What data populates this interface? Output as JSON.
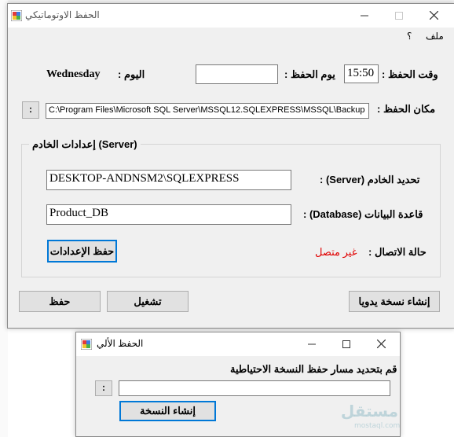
{
  "main_window": {
    "title": "الحفظ الاوتوماتيكي",
    "menu": {
      "file": "ملف",
      "help": "؟"
    },
    "backup_time": {
      "label": "وقت الحفظ :",
      "value": "15:50"
    },
    "backup_day": {
      "label": "يوم الحفظ :",
      "value": ""
    },
    "today": {
      "label": "اليوم :",
      "value": "Wednesday"
    },
    "backup_location": {
      "label": "مكان الحفظ :",
      "value": "C:\\Program Files\\Microsoft SQL Server\\MSSQL12.SQLEXPRESS\\MSSQL\\Backup",
      "browse": ":"
    },
    "server_group": {
      "title": "إعدادات الخادم (Server)",
      "server_label": "تحديد الخادم (Server) :",
      "server_value": "DESKTOP-ANDNSM2\\SQLEXPRESS",
      "database_label": "قاعدة البيانات (Database) :",
      "database_value": "Product_DB",
      "status_label": "حالة الاتصال :",
      "status_value": "غير متصل",
      "save_settings": "حفظ الإعدادات"
    },
    "buttons": {
      "manual_backup": "إنشاء نسخة يدويا",
      "run": "تشغيل",
      "save": "حفظ"
    }
  },
  "dialog": {
    "title": "الحفظ الألي",
    "prompt": "قم بتحديد مسار حفظ النسخة الاحتياطية",
    "path_value": "",
    "browse": ":",
    "create_button": "إنشاء النسخة"
  },
  "watermark": {
    "brand": "مستقل",
    "site": "mostaql.com"
  },
  "colors": {
    "status": "#e00000",
    "accent": "#0078d7",
    "window_bg": "#f0f0f0"
  }
}
